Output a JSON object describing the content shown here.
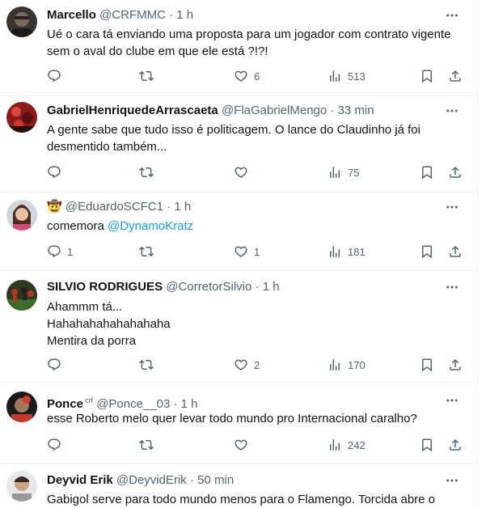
{
  "tweets": [
    {
      "name": "Marcello",
      "badge": "",
      "handle": "@CRFMMC",
      "time": "1 h",
      "lines": [
        "Ué o cara tá enviando uma proposta para um jogador com contrato vigente",
        "sem o aval do clube em que ele está ?!?!"
      ],
      "replies": "",
      "retweets": "",
      "likes": "6",
      "views": "513"
    },
    {
      "name": "GabrielHenriquedeArrascaeta",
      "badge": "",
      "handle": "@FlaGabrielMengo",
      "time": "33 min",
      "lines": [
        "A gente sabe que tudo isso é politicagem. O lance do Claudinho já foi",
        "desmentido também..."
      ],
      "replies": "",
      "retweets": "",
      "likes": "",
      "views": "75"
    },
    {
      "name": "🤠",
      "badge": "",
      "handle": "@EduardoSCFC1",
      "time": "1 h",
      "lines_prefix": "comemora ",
      "mention": "@DynamoKratz",
      "replies": "1",
      "retweets": "",
      "likes": "1",
      "views": "181"
    },
    {
      "name": "SILVIO RODRIGUES",
      "badge": "",
      "handle": "@CorretorSilvio",
      "time": "1 h",
      "lines": [
        "Ahammm tá...",
        "Hahahahahahahahaha",
        "Mentira da porra"
      ],
      "replies": "",
      "retweets": "",
      "likes": "2",
      "views": "170"
    },
    {
      "name": "Ponce",
      "badge": "crf",
      "handle": "@Ponce__03",
      "time": "1 h",
      "lines": [
        "esse Roberto melo quer levar todo mundo pro Internacional caralho?"
      ],
      "replies": "",
      "retweets": "",
      "likes": "",
      "views": "242"
    },
    {
      "name": "Deyvid Erik",
      "badge": "",
      "handle": "@DeyvidErik",
      "time": "50 min",
      "lines": [
        "Gabigol serve para todo mundo menos para o Flamengo. Torcida abre o"
      ]
    }
  ],
  "separator": "·",
  "colors": {
    "text": "#0f1419",
    "secondary": "#536471",
    "link": "#1d9bf0",
    "border": "#eff3f4"
  },
  "icons": [
    "reply-icon",
    "retweet-icon",
    "like-icon",
    "views-icon",
    "bookmark-icon",
    "share-icon",
    "more-icon"
  ]
}
